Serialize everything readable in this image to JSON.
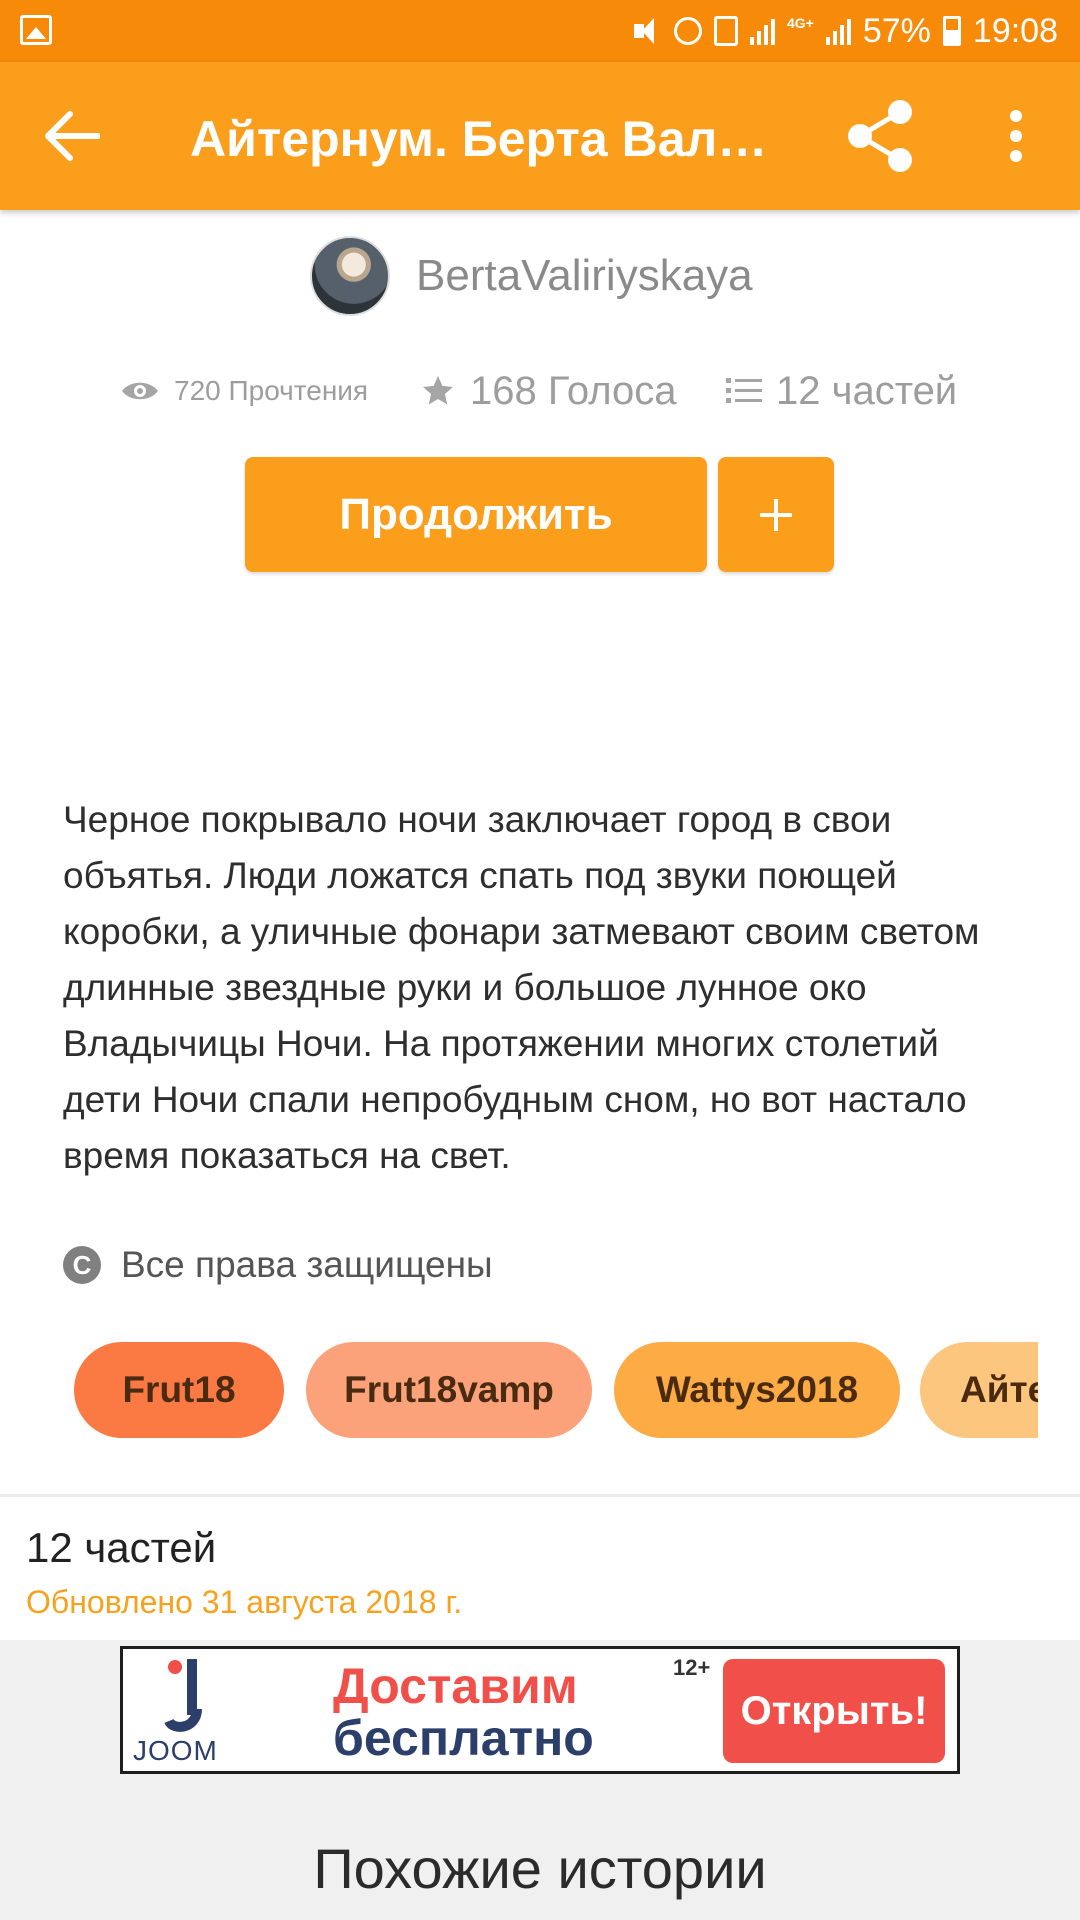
{
  "status_bar": {
    "battery": "57%",
    "time": "19:08",
    "network": "4G+"
  },
  "app_bar": {
    "title": "Айтернум. Берта Вали…"
  },
  "author": {
    "name": "BertaValiriyskaya"
  },
  "stats": {
    "reads": "720 Прочтения",
    "votes": "168 Голоса",
    "parts": "12 частей"
  },
  "actions": {
    "continue_label": "Продолжить",
    "add_label": "+"
  },
  "description": "Черное покрывало ночи заключает город в свои объятья. Люди ложатся спать под звуки поющей коробки, а уличные фонари затмевают своим светом длинные звездные руки и большое лунное око Владычицы Ночи. На протяжении многих столетий дети Ночи спали непробудным сном, но вот настало время показаться на свет.",
  "rights": {
    "icon": "copyright-icon",
    "label": "Все права защищены"
  },
  "tags": [
    {
      "label": "Frut18",
      "color": "#fb7a43"
    },
    {
      "label": "Frut18vamp",
      "color": "#fca27a"
    },
    {
      "label": "Wattys2018",
      "color": "#fcab45"
    },
    {
      "label": "Айте",
      "color": "#fdc67e"
    }
  ],
  "parts_section": {
    "count": "12 частей",
    "updated": "Обновлено 31 августа 2018 г."
  },
  "ad": {
    "logo": "JOOM",
    "headline_1": "Доставим",
    "headline_2": "бесплатно",
    "age": "12+",
    "cta": "Открыть!"
  },
  "similar": {
    "title": "Похожие истории"
  },
  "colors": {
    "status_bar": "#f78a08",
    "app_bar": "#fb9e1c",
    "accent": "#fb9e1c",
    "updated_text": "#f7a21e"
  }
}
